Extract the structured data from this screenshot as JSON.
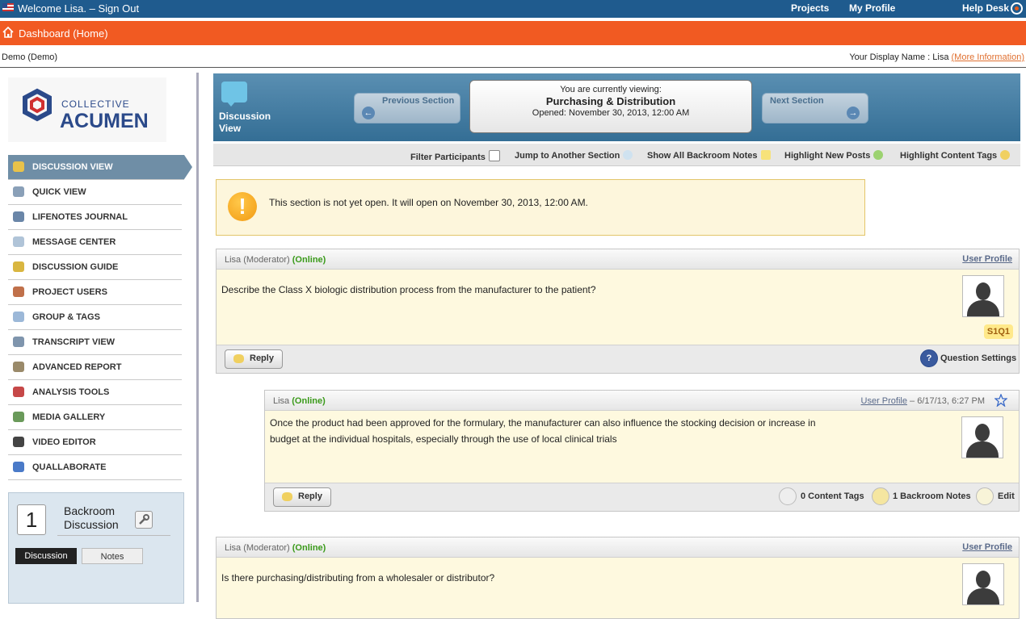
{
  "topbar": {
    "welcome": "Welcome Lisa. – Sign Out",
    "projects": "Projects",
    "my_profile": "My Profile",
    "help_desk": "Help Desk"
  },
  "dashboard": {
    "label": "Dashboard (Home)"
  },
  "infobar": {
    "project": "Demo (Demo)",
    "display_name_prefix": "Your Display Name : Lisa ",
    "more_info": "(More Information)"
  },
  "logo": {
    "line1": "COLLECTIVE",
    "line2": "ACUMEN"
  },
  "sidebar": {
    "items": [
      {
        "label": "DISCUSSION VIEW",
        "icon": "discussion-icon"
      },
      {
        "label": "QUICK VIEW",
        "icon": "magnifier-icon"
      },
      {
        "label": "LIFENOTES JOURNAL",
        "icon": "phone-icon"
      },
      {
        "label": "MESSAGE CENTER",
        "icon": "envelope-icon"
      },
      {
        "label": "DISCUSSION GUIDE",
        "icon": "guide-icon"
      },
      {
        "label": "PROJECT USERS",
        "icon": "user-icon"
      },
      {
        "label": "GROUP & TAGS",
        "icon": "tag-icon"
      },
      {
        "label": "TRANSCRIPT VIEW",
        "icon": "search-icon"
      },
      {
        "label": "ADVANCED REPORT",
        "icon": "report-icon"
      },
      {
        "label": "ANALYSIS TOOLS",
        "icon": "bar-chart-icon"
      },
      {
        "label": "MEDIA GALLERY",
        "icon": "gallery-icon"
      },
      {
        "label": "VIDEO EDITOR",
        "icon": "video-icon"
      },
      {
        "label": "QUALLABORATE",
        "icon": "pencil-icon"
      }
    ],
    "backroom": {
      "count": "1",
      "title_line1": "Backroom",
      "title_line2": "Discussion",
      "tab_discussion": "Discussion",
      "tab_notes": "Notes"
    }
  },
  "header": {
    "view_label_line1": "Discussion",
    "view_label_line2": "View",
    "prev": "Previous Section",
    "next": "Next Section",
    "currently": "You are currently viewing:",
    "section": "Purchasing & Distribution",
    "opened": "Opened: November 30, 2013, 12:00 AM"
  },
  "toolbar": {
    "filter": "Filter Participants",
    "jump": "Jump to Another Section",
    "backroom_notes": "Show All Backroom Notes",
    "highlight_posts": "Highlight New Posts",
    "highlight_tags": "Highlight Content Tags"
  },
  "alert": {
    "message": "This section is not yet open. It will open on November 30, 2013, 12:00 AM."
  },
  "posts": [
    {
      "author": "Lisa (Moderator) ",
      "status": "(Online)",
      "profile": "User Profile",
      "text": "Describe the Class X biologic distribution process from the manufacturer to the patient?",
      "tag": "S1Q1",
      "reply": "Reply",
      "settings": "Question Settings"
    },
    {
      "author": "Lisa ",
      "status": "(Online)",
      "profile": "User Profile",
      "meta": " – 6/17/13, 6:27 PM",
      "text_line1": "Once the product had been approved for the formulary, the manufacturer can also influence the stocking decision or increase in",
      "text_line2": "budget at the individual hospitals, especially through the use of local clinical trials",
      "reply": "Reply",
      "content_tags": "0 Content Tags",
      "backroom_notes": "1 Backroom Notes",
      "edit": "Edit"
    },
    {
      "author": "Lisa (Moderator) ",
      "status": "(Online)",
      "profile": "User Profile",
      "text": "Is there purchasing/distributing from a wholesaler or distributor?"
    }
  ]
}
